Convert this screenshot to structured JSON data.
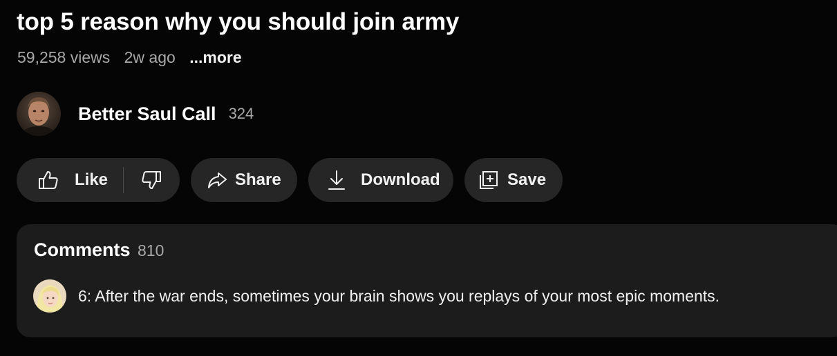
{
  "video": {
    "title": "top 5 reason why you should join army",
    "views": "59,258 views",
    "age": "2w ago",
    "more_label": "...more"
  },
  "channel": {
    "name": "Better Saul Call",
    "subscriber_count": "324",
    "avatar_icon": "channel-avatar"
  },
  "actions": {
    "like_label": "Like",
    "like_icon": "thumbs-up-icon",
    "dislike_icon": "thumbs-down-icon",
    "share_label": "Share",
    "share_icon": "share-arrow-icon",
    "download_label": "Download",
    "download_icon": "download-icon",
    "save_label": "Save",
    "save_icon": "playlist-add-icon"
  },
  "comments": {
    "title": "Comments",
    "count": "810",
    "top_comment": {
      "text": "6: After the war ends, sometimes your brain shows you replays of your most epic moments.",
      "avatar_icon": "commenter-avatar"
    }
  },
  "colors": {
    "background": "#050505",
    "pill_background": "#262626",
    "card_background": "#1c1c1c",
    "text_primary": "#f1f1f1",
    "text_secondary": "#a9a9a9"
  }
}
